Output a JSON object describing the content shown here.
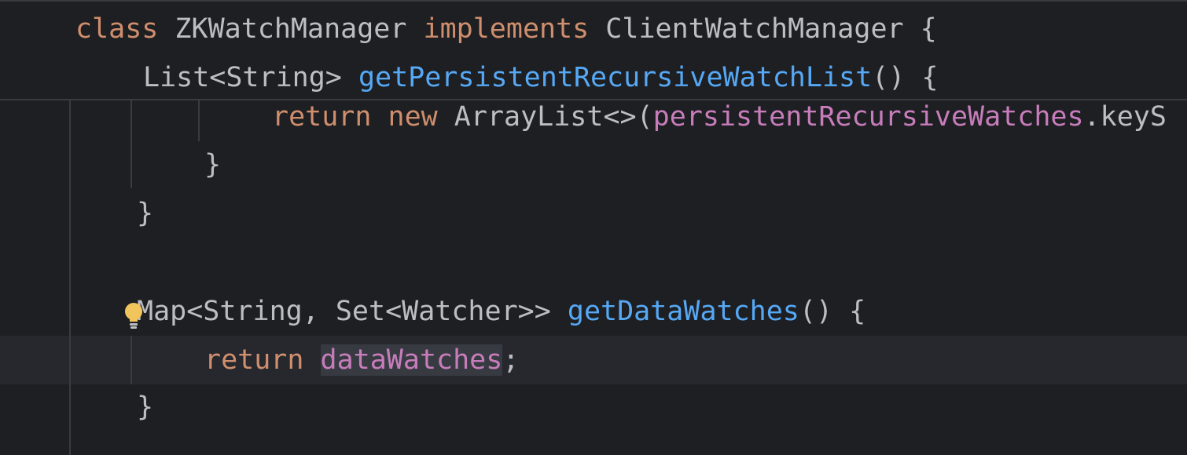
{
  "sticky_header": {
    "line1": {
      "kw_class": "class",
      "class_name": " ZKWatchManager ",
      "kw_implements": "implements",
      "interface_name": " ClientWatchManager {"
    },
    "line2": {
      "return_type": "List<String> ",
      "method_name": "getPersistentRecursiveWatchList",
      "tail": "() {"
    }
  },
  "code": {
    "l3": {
      "kw_return": "return",
      "sp1": " ",
      "kw_new": "new",
      "sp2": " ArrayList<>(",
      "field": "persistentRecursiveWatches",
      "tail": ".keyS"
    },
    "l4": {
      "brace": "}"
    },
    "l5": {
      "brace": "}"
    },
    "l6": {
      "return_type": "Map<String, Set<Watcher>> ",
      "method_name": "getDataWatches",
      "tail": "() {"
    },
    "l7": {
      "kw_return": "return",
      "sp": " ",
      "field": "dataWatches",
      "semi": ";"
    },
    "l8": {
      "brace": "}"
    }
  },
  "icons": {
    "intention_bulb": "lightbulb-icon"
  },
  "colors": {
    "background": "#1e1f22",
    "keyword": "#cf8e6d",
    "method": "#56a8f5",
    "field": "#c77dbb",
    "text": "#bcbec4",
    "bulb": "#f2c55c"
  }
}
